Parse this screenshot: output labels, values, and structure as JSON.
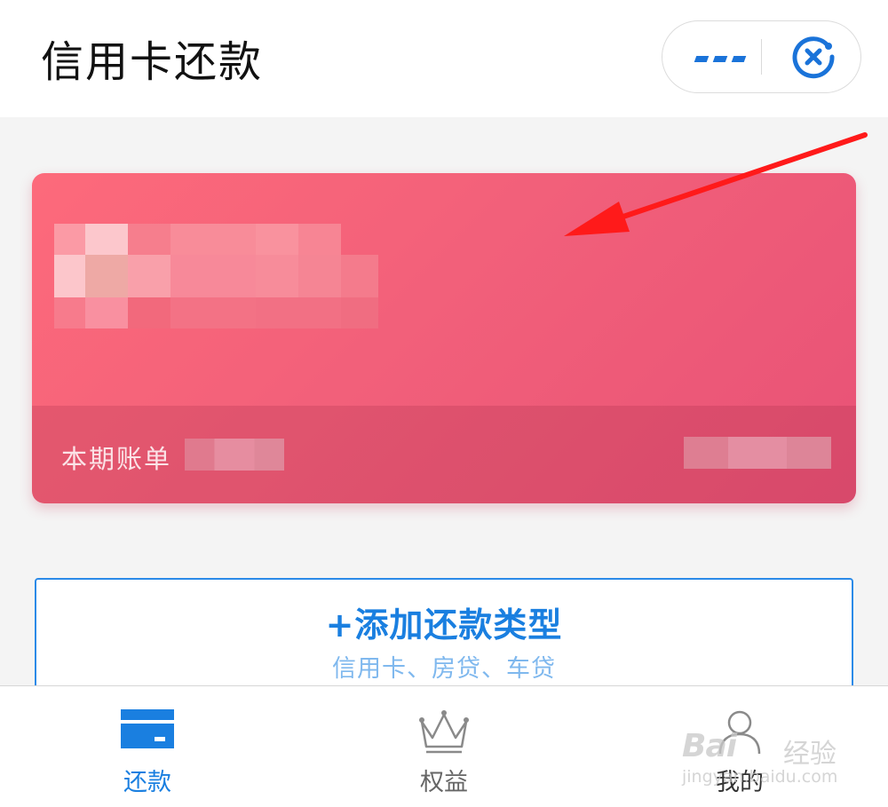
{
  "header": {
    "title": "信用卡还款",
    "more_icon": "more-dots-icon",
    "close_icon": "close-target-icon",
    "accent_color": "#1a73d9"
  },
  "bill_card": {
    "bill_label": "本期账单",
    "card_colors": [
      "#fd6a7b",
      "#e85276"
    ]
  },
  "add_type": {
    "title": "+添加还款类型",
    "subtitle": "信用卡、房贷、车贷",
    "accent_color": "#1a7fe0"
  },
  "tabbar": {
    "items": [
      {
        "label": "还款",
        "icon": "card-icon",
        "active": true
      },
      {
        "label": "权益",
        "icon": "crown-icon",
        "active": false
      },
      {
        "label": "我的",
        "icon": "user-icon",
        "active": false
      }
    ]
  },
  "watermark": {
    "brand": "Bai",
    "brand_cn": "经验",
    "url": "jingyan.baidu.com"
  }
}
